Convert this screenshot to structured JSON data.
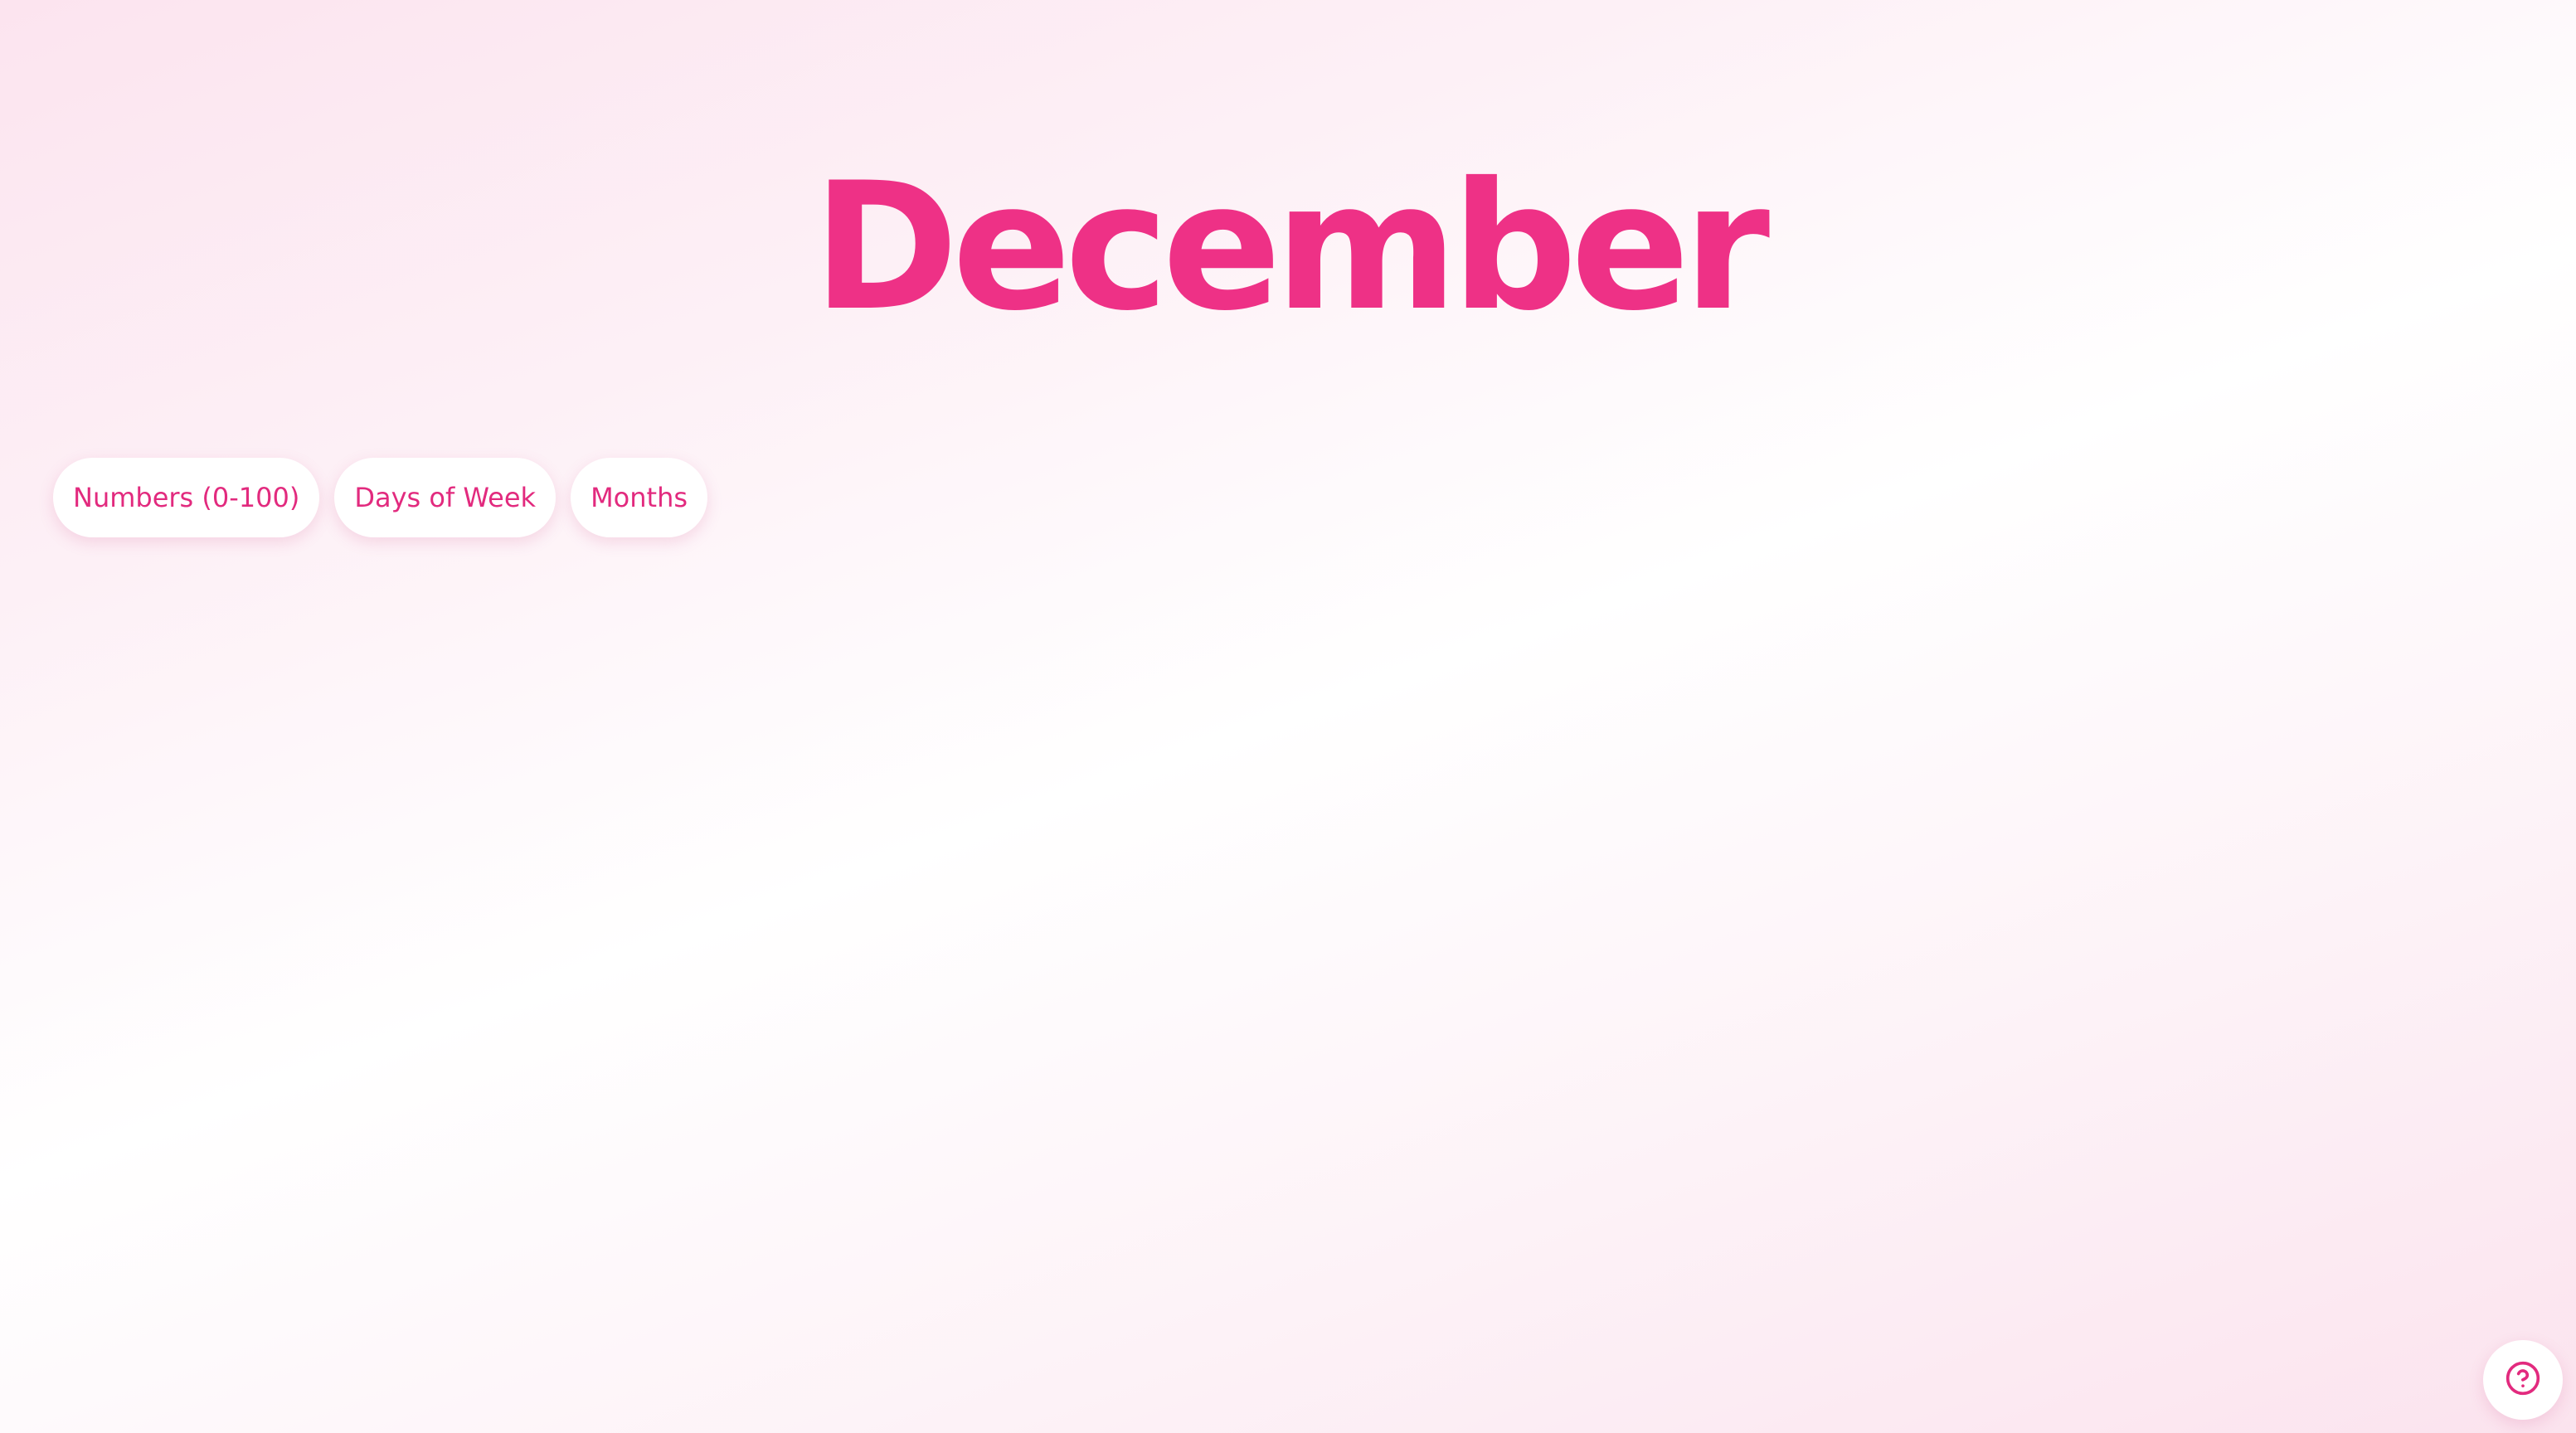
{
  "display": {
    "word": "December"
  },
  "categories": [
    {
      "label": "Numbers (0-100)"
    },
    {
      "label": "Days of Week"
    },
    {
      "label": "Months"
    }
  ],
  "help": {
    "icon": "help-circle-icon"
  },
  "colors": {
    "accent": "#ee3186",
    "pill_text": "#e22a7e",
    "pill_background": "#ffffff"
  }
}
